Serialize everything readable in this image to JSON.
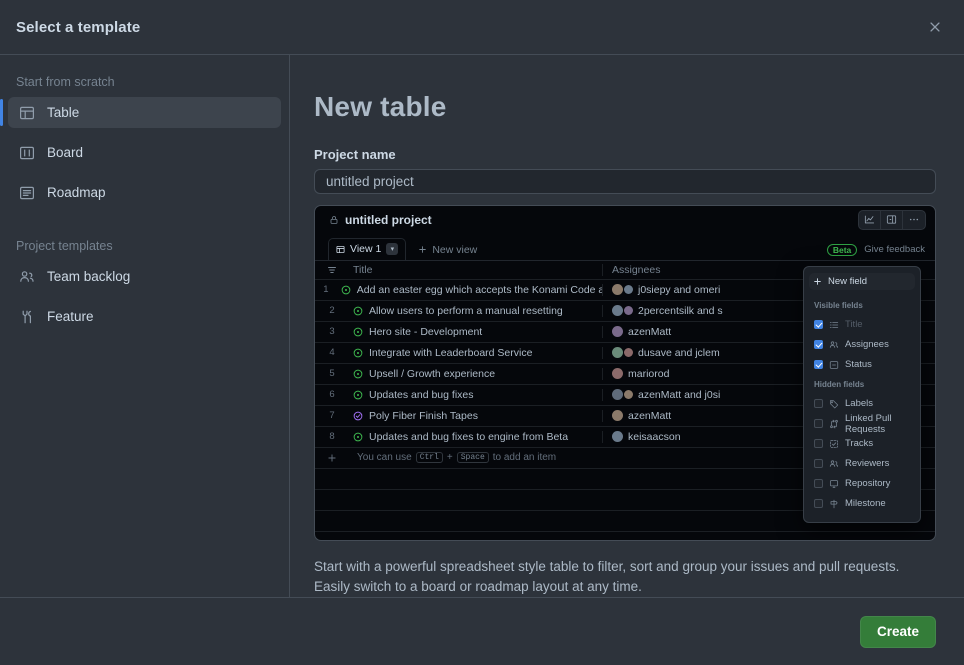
{
  "dialog": {
    "title": "Select a template",
    "close_label": "Close"
  },
  "sidebar": {
    "groups": [
      {
        "label": "Start from scratch",
        "items": [
          {
            "label": "Table",
            "icon": "table-icon",
            "selected": true
          },
          {
            "label": "Board",
            "icon": "board-icon",
            "selected": false
          },
          {
            "label": "Roadmap",
            "icon": "roadmap-icon",
            "selected": false
          }
        ]
      },
      {
        "label": "Project templates",
        "items": [
          {
            "label": "Team backlog",
            "icon": "people-icon",
            "selected": false
          },
          {
            "label": "Feature",
            "icon": "tools-icon",
            "selected": false
          }
        ]
      }
    ]
  },
  "main": {
    "heading": "New table",
    "project_name_label": "Project name",
    "project_name_value": "untitled project",
    "project_name_placeholder": "untitled project",
    "description": "Start with a powerful spreadsheet style table to filter, sort and group your issues and pull requests. Easily switch to a board or roadmap layout at any time."
  },
  "preview": {
    "project_title": "untitled project",
    "lock_icon": "lock-icon",
    "toolbar_icons": [
      "insights-icon",
      "sidebar-panel-icon",
      "kebab-menu-icon"
    ],
    "tab_label": "View 1",
    "tab_icon": "table-icon",
    "tab_caret": "▾",
    "new_view_label": "New view",
    "beta_badge": "Beta",
    "feedback_label": "Give feedback",
    "columns": [
      "Title",
      "Assignees"
    ],
    "filter_icon": "filter-icon",
    "rows": [
      {
        "num": "1",
        "status": "open",
        "title": "Add an easter egg which accepts the Konami Code and shows Octocat fireworks",
        "has_emoji": true,
        "assignees": "j0siepy and omeri",
        "avatars": 2
      },
      {
        "num": "2",
        "status": "open",
        "title": "Allow users to perform a manual resetting",
        "has_emoji": false,
        "assignees": "2percentsilk and s",
        "avatars": 2
      },
      {
        "num": "3",
        "status": "open",
        "title": "Hero site - Development",
        "has_emoji": false,
        "assignees": "azenMatt",
        "avatars": 1
      },
      {
        "num": "4",
        "status": "open",
        "title": "Integrate with Leaderboard Service",
        "has_emoji": false,
        "assignees": "dusave and jclem",
        "avatars": 2
      },
      {
        "num": "5",
        "status": "open",
        "title": "Upsell / Growth experience",
        "has_emoji": false,
        "assignees": "mariorod",
        "avatars": 1
      },
      {
        "num": "6",
        "status": "open",
        "title": "Updates and bug fixes",
        "has_emoji": false,
        "assignees": "azenMatt and j0si",
        "avatars": 2
      },
      {
        "num": "7",
        "status": "done",
        "title": "Poly Fiber Finish Tapes",
        "has_emoji": false,
        "assignees": "azenMatt",
        "avatars": 1
      },
      {
        "num": "8",
        "status": "open",
        "title": "Updates and bug fixes to engine from Beta",
        "has_emoji": false,
        "assignees": "keisaacson",
        "avatars": 1
      }
    ],
    "add_item_prefix": "You can use",
    "add_item_key1": "Ctrl",
    "add_item_plus": "+",
    "add_item_key2": "Space",
    "add_item_suffix": "to add an item"
  },
  "field_menu": {
    "new_field_label": "New field",
    "new_field_icon": "plus-icon",
    "visible_section": "Visible fields",
    "hidden_section": "Hidden fields",
    "visible_fields": [
      {
        "label": "Title",
        "icon": "list-icon",
        "checked": true,
        "disabled": true
      },
      {
        "label": "Assignees",
        "icon": "people-icon",
        "checked": true,
        "disabled": false
      },
      {
        "label": "Status",
        "icon": "status-icon",
        "checked": true,
        "disabled": false
      }
    ],
    "hidden_fields": [
      {
        "label": "Labels",
        "icon": "tag-icon",
        "checked": false,
        "disabled": false
      },
      {
        "label": "Linked Pull Requests",
        "icon": "git-pr-icon",
        "checked": false,
        "disabled": false
      },
      {
        "label": "Tracks",
        "icon": "tracks-icon",
        "checked": false,
        "disabled": false
      },
      {
        "label": "Reviewers",
        "icon": "people-icon",
        "checked": false,
        "disabled": false
      },
      {
        "label": "Repository",
        "icon": "repo-icon",
        "checked": false,
        "disabled": false
      },
      {
        "label": "Milestone",
        "icon": "milestone-icon",
        "checked": false,
        "disabled": false
      }
    ]
  },
  "footer": {
    "create_label": "Create"
  },
  "colors": {
    "dialog_bg": "#2d333b",
    "border": "#444c56",
    "accent_blue": "#4184e4",
    "create_green": "#347d39",
    "status_open_green": "#3fb950",
    "status_done_purple": "#a371f7",
    "preview_bg": "#05070b"
  }
}
